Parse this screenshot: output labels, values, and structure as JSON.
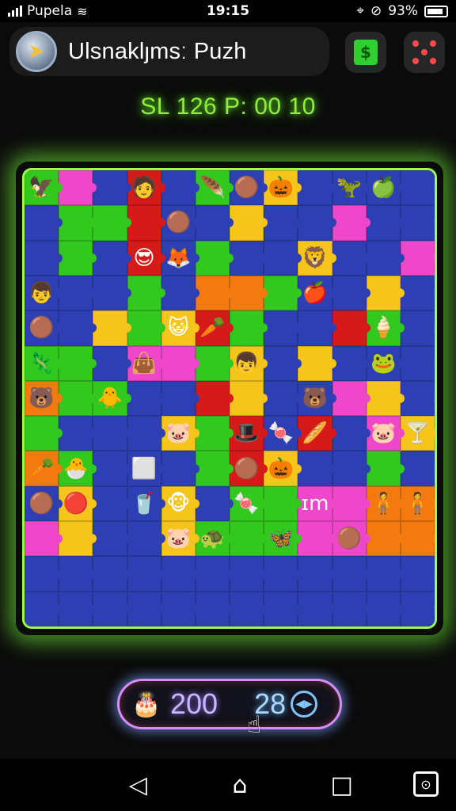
{
  "status": {
    "carrier": "Pupela",
    "time": "19:15",
    "battery": "93%"
  },
  "header": {
    "title": "Ulsnaklȷmsː Puzh",
    "share_icon": "share-icon",
    "menu_icon": "grid-dots-icon"
  },
  "readout": "SL 126 P: 00 10",
  "board": {
    "rows": [
      [
        {
          "c": "g",
          "i": "🦅"
        },
        {
          "c": "p",
          "i": ""
        },
        {
          "c": "b",
          "i": ""
        },
        {
          "c": "r",
          "i": "🧑"
        },
        {
          "c": "b",
          "i": ""
        },
        {
          "c": "g",
          "i": "🪶"
        },
        {
          "c": "b",
          "i": "🟤"
        },
        {
          "c": "y",
          "i": "🎃"
        },
        {
          "c": "b",
          "i": ""
        },
        {
          "c": "b",
          "i": "🦖"
        },
        {
          "c": "b",
          "i": "🍏"
        },
        {
          "c": "b",
          "i": ""
        }
      ],
      [
        {
          "c": "b",
          "i": ""
        },
        {
          "c": "g",
          "i": ""
        },
        {
          "c": "g",
          "i": ""
        },
        {
          "c": "r",
          "i": ""
        },
        {
          "c": "b",
          "i": "🟤"
        },
        {
          "c": "b",
          "i": ""
        },
        {
          "c": "y",
          "i": ""
        },
        {
          "c": "b",
          "i": ""
        },
        {
          "c": "b",
          "i": ""
        },
        {
          "c": "p",
          "i": ""
        },
        {
          "c": "b",
          "i": ""
        },
        {
          "c": "b",
          "i": ""
        }
      ],
      [
        {
          "c": "b",
          "i": ""
        },
        {
          "c": "g",
          "i": ""
        },
        {
          "c": "b",
          "i": ""
        },
        {
          "c": "r",
          "i": "😎"
        },
        {
          "c": "b",
          "i": "🦊"
        },
        {
          "c": "g",
          "i": ""
        },
        {
          "c": "b",
          "i": ""
        },
        {
          "c": "b",
          "i": ""
        },
        {
          "c": "y",
          "i": "🦁"
        },
        {
          "c": "b",
          "i": ""
        },
        {
          "c": "b",
          "i": ""
        },
        {
          "c": "p",
          "i": ""
        }
      ],
      [
        {
          "c": "b",
          "i": "👦"
        },
        {
          "c": "b",
          "i": ""
        },
        {
          "c": "b",
          "i": ""
        },
        {
          "c": "g",
          "i": ""
        },
        {
          "c": "b",
          "i": ""
        },
        {
          "c": "o",
          "i": ""
        },
        {
          "c": "o",
          "i": ""
        },
        {
          "c": "g",
          "i": ""
        },
        {
          "c": "b",
          "i": "🍎"
        },
        {
          "c": "b",
          "i": ""
        },
        {
          "c": "y",
          "i": ""
        },
        {
          "c": "b",
          "i": ""
        }
      ],
      [
        {
          "c": "b",
          "i": "🟤"
        },
        {
          "c": "b",
          "i": ""
        },
        {
          "c": "y",
          "i": ""
        },
        {
          "c": "g",
          "i": ""
        },
        {
          "c": "y",
          "i": "😺"
        },
        {
          "c": "r",
          "i": "🥕"
        },
        {
          "c": "g",
          "i": ""
        },
        {
          "c": "b",
          "i": ""
        },
        {
          "c": "b",
          "i": ""
        },
        {
          "c": "r",
          "i": ""
        },
        {
          "c": "g",
          "i": "🍦"
        },
        {
          "c": "b",
          "i": ""
        }
      ],
      [
        {
          "c": "g",
          "i": "🦎"
        },
        {
          "c": "g",
          "i": ""
        },
        {
          "c": "b",
          "i": ""
        },
        {
          "c": "p",
          "i": "👜"
        },
        {
          "c": "p",
          "i": ""
        },
        {
          "c": "g",
          "i": ""
        },
        {
          "c": "y",
          "i": "👦"
        },
        {
          "c": "b",
          "i": ""
        },
        {
          "c": "y",
          "i": ""
        },
        {
          "c": "b",
          "i": ""
        },
        {
          "c": "b",
          "i": "🐸"
        },
        {
          "c": "b",
          "i": ""
        }
      ],
      [
        {
          "c": "o",
          "i": "🐻"
        },
        {
          "c": "g",
          "i": ""
        },
        {
          "c": "g",
          "i": "🐥"
        },
        {
          "c": "b",
          "i": ""
        },
        {
          "c": "b",
          "i": ""
        },
        {
          "c": "r",
          "i": ""
        },
        {
          "c": "y",
          "i": ""
        },
        {
          "c": "b",
          "i": ""
        },
        {
          "c": "b",
          "i": "🐻"
        },
        {
          "c": "p",
          "i": ""
        },
        {
          "c": "y",
          "i": ""
        },
        {
          "c": "b",
          "i": ""
        }
      ],
      [
        {
          "c": "g",
          "i": ""
        },
        {
          "c": "b",
          "i": ""
        },
        {
          "c": "b",
          "i": ""
        },
        {
          "c": "b",
          "i": ""
        },
        {
          "c": "y",
          "i": "🐷"
        },
        {
          "c": "g",
          "i": ""
        },
        {
          "c": "r",
          "i": "🎩"
        },
        {
          "c": "b",
          "i": "🍬"
        },
        {
          "c": "r",
          "i": "🥖"
        },
        {
          "c": "b",
          "i": ""
        },
        {
          "c": "p",
          "i": "🐷"
        },
        {
          "c": "y",
          "i": "🍸"
        }
      ],
      [
        {
          "c": "o",
          "i": "🥕"
        },
        {
          "c": "g",
          "i": "🐣"
        },
        {
          "c": "b",
          "i": ""
        },
        {
          "c": "b",
          "i": "⬜"
        },
        {
          "c": "b",
          "i": ""
        },
        {
          "c": "g",
          "i": ""
        },
        {
          "c": "r",
          "i": "🟤"
        },
        {
          "c": "y",
          "i": "🎃"
        },
        {
          "c": "b",
          "i": ""
        },
        {
          "c": "b",
          "i": ""
        },
        {
          "c": "g",
          "i": ""
        },
        {
          "c": "b",
          "i": ""
        }
      ],
      [
        {
          "c": "b",
          "i": "🟤"
        },
        {
          "c": "y",
          "i": "🔴"
        },
        {
          "c": "b",
          "i": ""
        },
        {
          "c": "b",
          "i": "🥤"
        },
        {
          "c": "y",
          "i": "🐵"
        },
        {
          "c": "b",
          "i": ""
        },
        {
          "c": "g",
          "i": "🍬"
        },
        {
          "c": "g",
          "i": ""
        },
        {
          "c": "p",
          "i": "ɪm"
        },
        {
          "c": "p",
          "i": ""
        },
        {
          "c": "o",
          "i": "🧍"
        },
        {
          "c": "o",
          "i": "🧍"
        }
      ],
      [
        {
          "c": "p",
          "i": ""
        },
        {
          "c": "y",
          "i": ""
        },
        {
          "c": "b",
          "i": ""
        },
        {
          "c": "b",
          "i": ""
        },
        {
          "c": "y",
          "i": "🐷"
        },
        {
          "c": "g",
          "i": "🐢"
        },
        {
          "c": "g",
          "i": ""
        },
        {
          "c": "g",
          "i": "🦋"
        },
        {
          "c": "p",
          "i": ""
        },
        {
          "c": "p",
          "i": "🟤"
        },
        {
          "c": "o",
          "i": ""
        },
        {
          "c": "o",
          "i": ""
        }
      ],
      [
        {
          "c": "b",
          "i": ""
        },
        {
          "c": "b",
          "i": ""
        },
        {
          "c": "b",
          "i": ""
        },
        {
          "c": "b",
          "i": ""
        },
        {
          "c": "b",
          "i": ""
        },
        {
          "c": "b",
          "i": ""
        },
        {
          "c": "b",
          "i": ""
        },
        {
          "c": "b",
          "i": ""
        },
        {
          "c": "b",
          "i": ""
        },
        {
          "c": "b",
          "i": ""
        },
        {
          "c": "b",
          "i": ""
        },
        {
          "c": "b",
          "i": ""
        }
      ],
      [
        {
          "c": "b",
          "i": ""
        },
        {
          "c": "b",
          "i": ""
        },
        {
          "c": "b",
          "i": ""
        },
        {
          "c": "b",
          "i": ""
        },
        {
          "c": "b",
          "i": ""
        },
        {
          "c": "b",
          "i": ""
        },
        {
          "c": "b",
          "i": ""
        },
        {
          "c": "b",
          "i": ""
        },
        {
          "c": "b",
          "i": ""
        },
        {
          "c": "b",
          "i": ""
        },
        {
          "c": "b",
          "i": ""
        },
        {
          "c": "b",
          "i": ""
        }
      ]
    ]
  },
  "counter": {
    "icon": "cake-icon",
    "value_a": "200",
    "value_b": "28",
    "next_icon": "play-icon"
  },
  "nav": {
    "back_icon": "back-icon",
    "home_icon": "home-icon",
    "recents_icon": "recents-icon",
    "extra_icon": "screenshot-icon"
  }
}
